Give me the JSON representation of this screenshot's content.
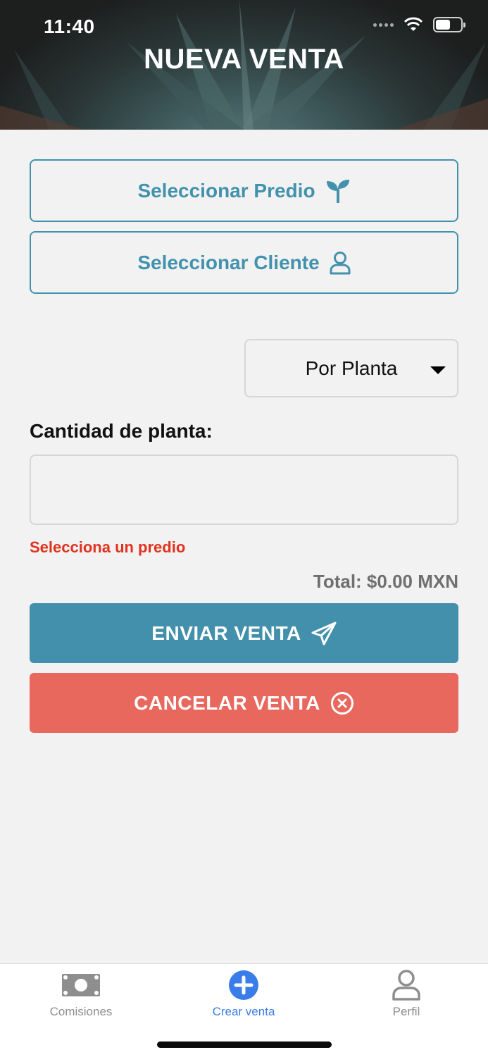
{
  "status_bar": {
    "time": "11:40"
  },
  "header": {
    "title": "NUEVA VENTA"
  },
  "buttons": {
    "select_predio": "Seleccionar Predio",
    "select_cliente": "Seleccionar Cliente",
    "enviar": "ENVIAR VENTA",
    "cancelar": "CANCELAR VENTA"
  },
  "sale_type_select": {
    "selected": "Por Planta"
  },
  "quantity": {
    "label": "Cantidad de planta:",
    "value": ""
  },
  "error": "Selecciona un predio",
  "total": "Total: $0.00 MXN",
  "colors": {
    "primary": "#4292ad",
    "danger": "#e8685e",
    "error_text": "#e0321e",
    "tab_active": "#3a7de8"
  },
  "tabs": [
    {
      "label": "Comisiones",
      "icon": "money-icon",
      "active": false
    },
    {
      "label": "Crear venta",
      "icon": "plus-circle-icon",
      "active": true
    },
    {
      "label": "Perfil",
      "icon": "user-icon",
      "active": false
    }
  ]
}
